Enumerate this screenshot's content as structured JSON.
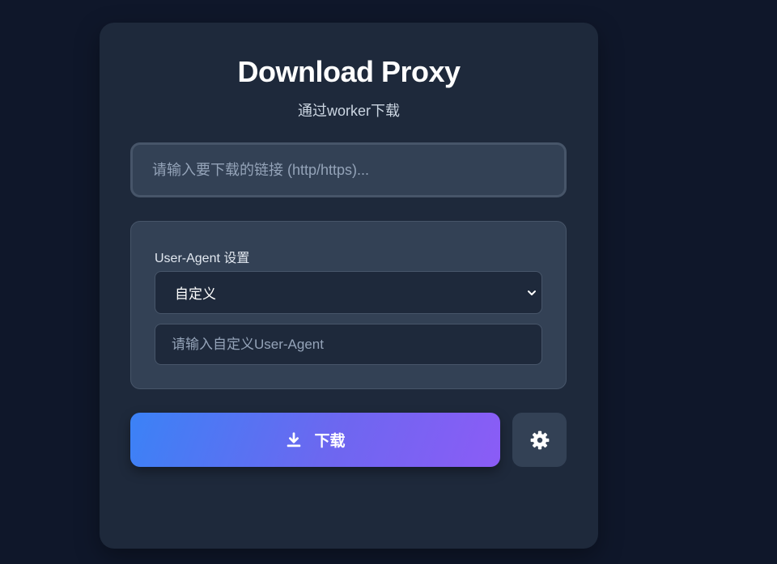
{
  "header": {
    "title": "Download Proxy",
    "subtitle": "通过worker下载"
  },
  "url_input": {
    "placeholder": "请输入要下载的链接 (http/https)...",
    "value": ""
  },
  "user_agent": {
    "label": "User-Agent 设置",
    "selected": "自定义",
    "custom_placeholder": "请输入自定义User-Agent",
    "custom_value": ""
  },
  "actions": {
    "download_label": "下载",
    "download_icon": "download-icon",
    "settings_icon": "gear-icon"
  },
  "colors": {
    "background": "#0f172a",
    "card": "#1e293b",
    "panel": "#334155",
    "gradient_start": "#3b82f6",
    "gradient_end": "#8b5cf6"
  }
}
